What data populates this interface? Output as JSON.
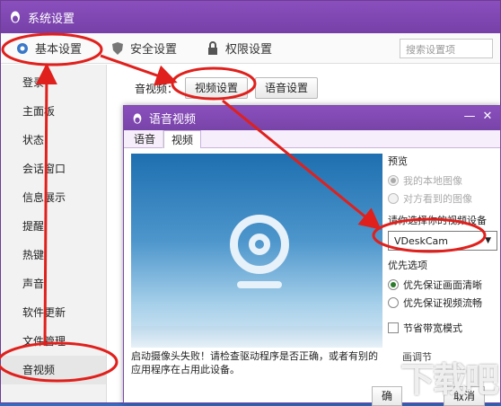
{
  "window": {
    "title": "系统设置",
    "title_icon": "penguin-icon"
  },
  "tabs": [
    {
      "label": "基本设置",
      "icon": "gear-icon",
      "active": true
    },
    {
      "label": "安全设置",
      "icon": "shield-icon"
    },
    {
      "label": "权限设置",
      "icon": "lock-icon"
    }
  ],
  "search": {
    "placeholder": "搜索设置项"
  },
  "sidebar": {
    "items": [
      {
        "label": "登录"
      },
      {
        "label": "主面板"
      },
      {
        "label": "状态"
      },
      {
        "label": "会话窗口"
      },
      {
        "label": "信息展示"
      },
      {
        "label": "提醒"
      },
      {
        "label": "热键"
      },
      {
        "label": "声音"
      },
      {
        "label": "软件更新"
      },
      {
        "label": "文件管理"
      },
      {
        "label": "音视频",
        "active": true
      }
    ]
  },
  "content": {
    "av_label": "音视频：",
    "video_btn": "视频设置",
    "audio_btn": "语音设置"
  },
  "dialog": {
    "title": "语音视频",
    "tabs": [
      "语音",
      "视频"
    ],
    "error_text": "启动摄像头失败！请检查驱动程序是否正确，或者有别的应用程序在占用此设备。",
    "preview_label": "预览",
    "preview_opts": [
      "我的本地图像",
      "对方看到的图像"
    ],
    "device_label": "请你选择你的视频设备",
    "device_value": "VDeskCam",
    "priority_label": "优先选项",
    "priority_opts": [
      "优先保证画面清晰",
      "优先保证视频流畅"
    ],
    "bandwidth_label": "节省带宽模式",
    "footer_partial": "画调节",
    "ok_partial": "确",
    "cancel_partial": "取消"
  },
  "watermark": "下载吧",
  "colors": {
    "titlebar": "#7c45ae",
    "annotation": "#e0201c"
  }
}
